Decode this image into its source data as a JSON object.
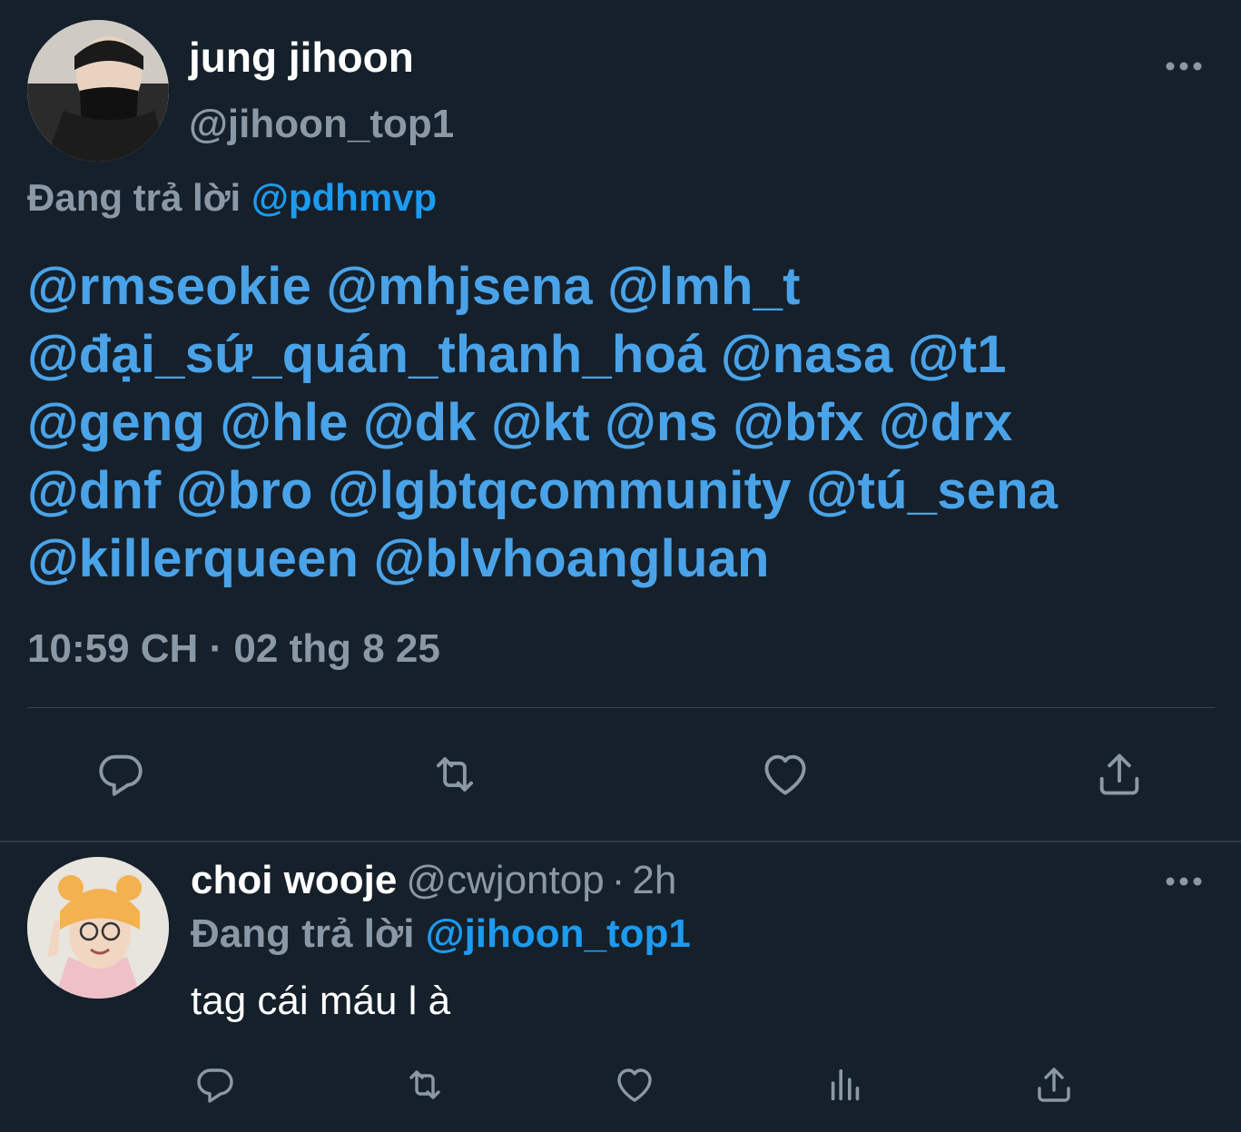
{
  "main_tweet": {
    "author_name": "jung jihoon",
    "author_handle": "@jihoon_top1",
    "replying_label": "Đang trả lời",
    "replying_to": "@pdhmvp",
    "mention_lines": [
      "@rmseokie @mhjsena @lmh_t",
      "@đại_sứ_quán_thanh_hoá @nasa @t1",
      "@geng @hle @dk @kt @ns @bfx @drx",
      "@dnf @bro @lgbtqcommunity @tú_sena",
      "@killerqueen @blvhoangluan"
    ],
    "timestamp": "10:59 CH · 02 thg 8 25",
    "actions": [
      "reply-icon",
      "retweet-icon",
      "like-icon",
      "share-icon"
    ]
  },
  "reply_tweet": {
    "author_name": "choi wooje",
    "author_handle": "@cwjontop",
    "separator": "·",
    "time": "2h",
    "replying_label": "Đang trả lời",
    "replying_to": "@jihoon_top1",
    "text": "tag cái máu l à",
    "actions": [
      "reply-icon",
      "retweet-icon",
      "like-icon",
      "views-icon",
      "share-icon"
    ]
  },
  "colors": {
    "background": "#15202b",
    "accent": "#1d9bf0",
    "secondary_text": "#8b98a5",
    "divider": "#38444d"
  }
}
